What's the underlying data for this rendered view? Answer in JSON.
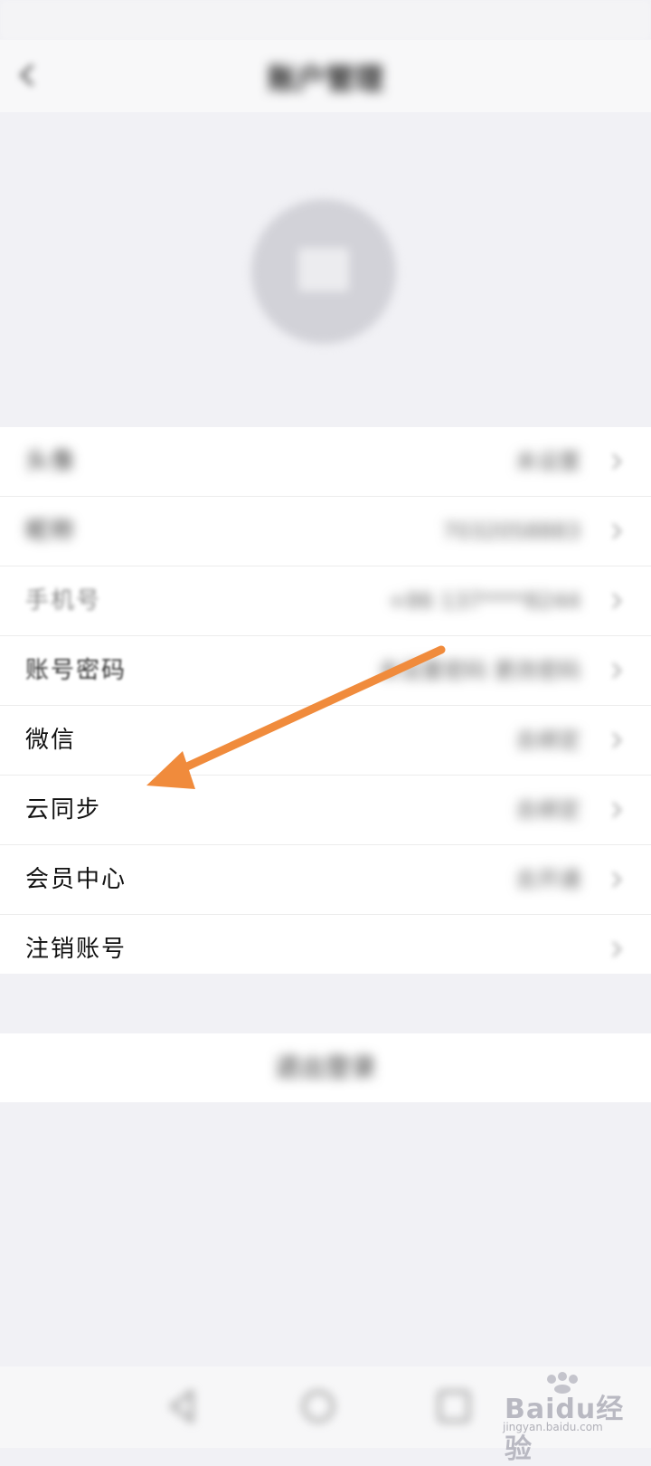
{
  "header": {
    "title": "账户管理"
  },
  "list": {
    "rows": [
      {
        "label": "头像",
        "value": "未设置"
      },
      {
        "label": "昵称",
        "value": "7032058883"
      },
      {
        "label": "手机号",
        "value": "+86 137****8244"
      },
      {
        "label": "账号密码",
        "value": "未设置密码 更改密码"
      },
      {
        "label": "微信",
        "value": "去绑定"
      },
      {
        "label": "云同步",
        "value": "去绑定"
      },
      {
        "label": "会员中心",
        "value": "去开通"
      },
      {
        "label": "注销账号",
        "value": ""
      }
    ]
  },
  "logout": {
    "label": "退出登录"
  },
  "annotation": {
    "arrow_color": "#f08b3c",
    "points_to": "云同步"
  },
  "watermark": {
    "brand": "Baidu经验",
    "url": "jingyan.baidu.com"
  },
  "colors": {
    "background": "#f1f1f5",
    "row_background": "#ffffff",
    "avatar": "#d2d2d8"
  },
  "icons": [
    "back-icon",
    "chevron-right-icon",
    "avatar-placeholder-icon",
    "nav-back-icon",
    "nav-home-icon",
    "nav-recent-icon",
    "baidu-paw-icon"
  ]
}
